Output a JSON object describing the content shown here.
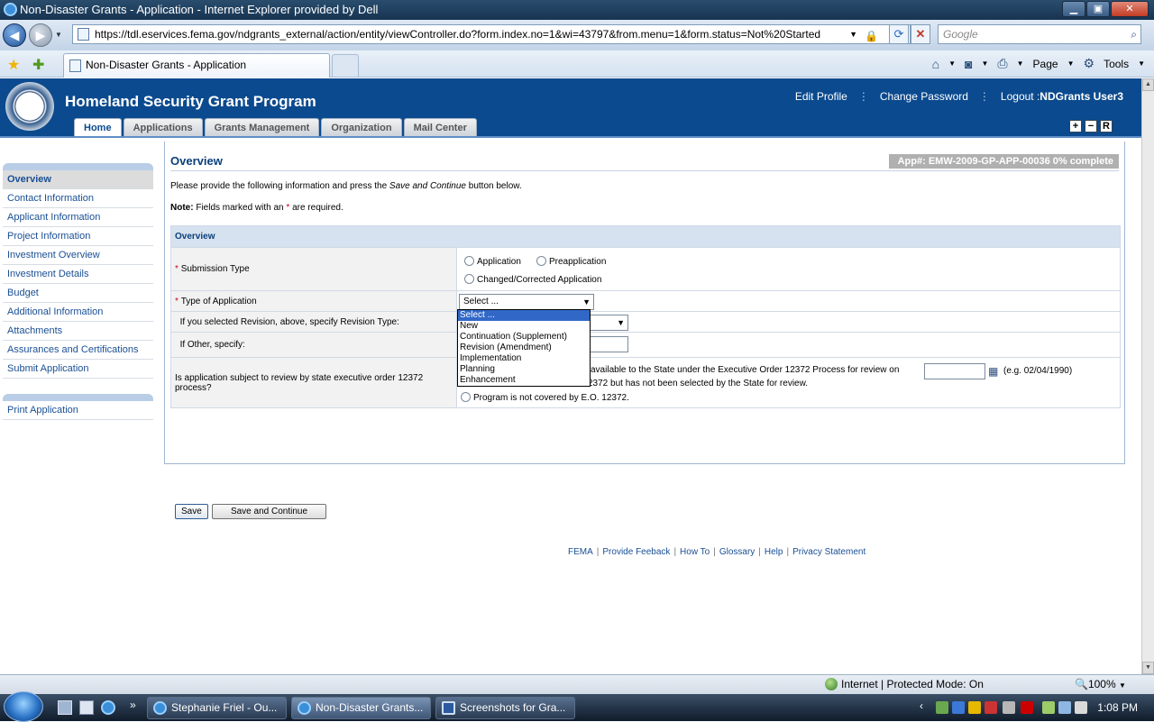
{
  "window": {
    "title": "Non-Disaster Grants - Application - Internet Explorer provided by Dell",
    "url": "https://tdl.eservices.fema.gov/ndgrants_external/action/entity/viewController.do?form.index.no=1&wi=43797&from.menu=1&form.status=Not%20Started",
    "search_placeholder": "Google",
    "tab_title": "Non-Disaster Grants - Application",
    "cmd_page": "Page",
    "cmd_tools": "Tools"
  },
  "header": {
    "brand": "Homeland Security Grant Program",
    "edit_profile": "Edit Profile",
    "change_password": "Change Password",
    "logout": "Logout :",
    "user": "NDGrants User3",
    "tabs": [
      "Home",
      "Applications",
      "Grants Management",
      "Organization",
      "Mail Center"
    ],
    "size_buttons": [
      "+",
      "−",
      "R"
    ]
  },
  "sidebar": {
    "items": [
      "Overview",
      "Contact Information",
      "Applicant Information",
      "Project Information",
      "Investment Overview",
      "Investment Details",
      "Budget",
      "Additional Information",
      "Attachments",
      "Assurances and Certifications",
      "Submit Application"
    ],
    "print": "Print Application"
  },
  "main": {
    "title": "Overview",
    "app_number": "App#: EMW-2009-GP-APP-00036 0% complete",
    "intro_before": "Please provide the following information and press the ",
    "intro_em": "Save and Continue",
    "intro_after": " button below.",
    "note_label": "Note:",
    "note_before": " Fields marked with an ",
    "note_star": "*",
    "note_after": " are required.",
    "section": "Overview",
    "submission_type": {
      "label": "Submission Type",
      "options": [
        "Application",
        "Preapplication",
        "Changed/Corrected Application"
      ]
    },
    "type_of_application": {
      "label": "Type of Application",
      "selected": "Select ...",
      "options": [
        "Select ...",
        "New",
        "Continuation (Supplement)",
        "Revision (Amendment)",
        "Implementation",
        "Planning",
        "Enhancement"
      ]
    },
    "revision_label": "If you selected Revision, above, specify Revision Type:",
    "other_label": "If Other, specify:",
    "eo": {
      "label": "Is application subject to review by state executive order 12372 process?",
      "opt1": "available to the State under the Executive Order 12372 Process for review on",
      "date_hint": "(e.g. 02/04/1990)",
      "opt2": "2372 but has not been selected by the State for review.",
      "opt3": "Program is not covered by E.O. 12372."
    },
    "save": "Save",
    "save_continue": "Save and Continue"
  },
  "footer": [
    "FEMA",
    "Provide Feeback",
    "How To",
    "Glossary",
    "Help",
    "Privacy Statement"
  ],
  "status": {
    "zone": "Internet | Protected Mode: On",
    "zoom": "100%"
  },
  "taskbar": {
    "items": [
      "Stephanie Friel - Ou...",
      "Non-Disaster Grants...",
      "Screenshots for Gra..."
    ],
    "clock": "1:08 PM"
  }
}
